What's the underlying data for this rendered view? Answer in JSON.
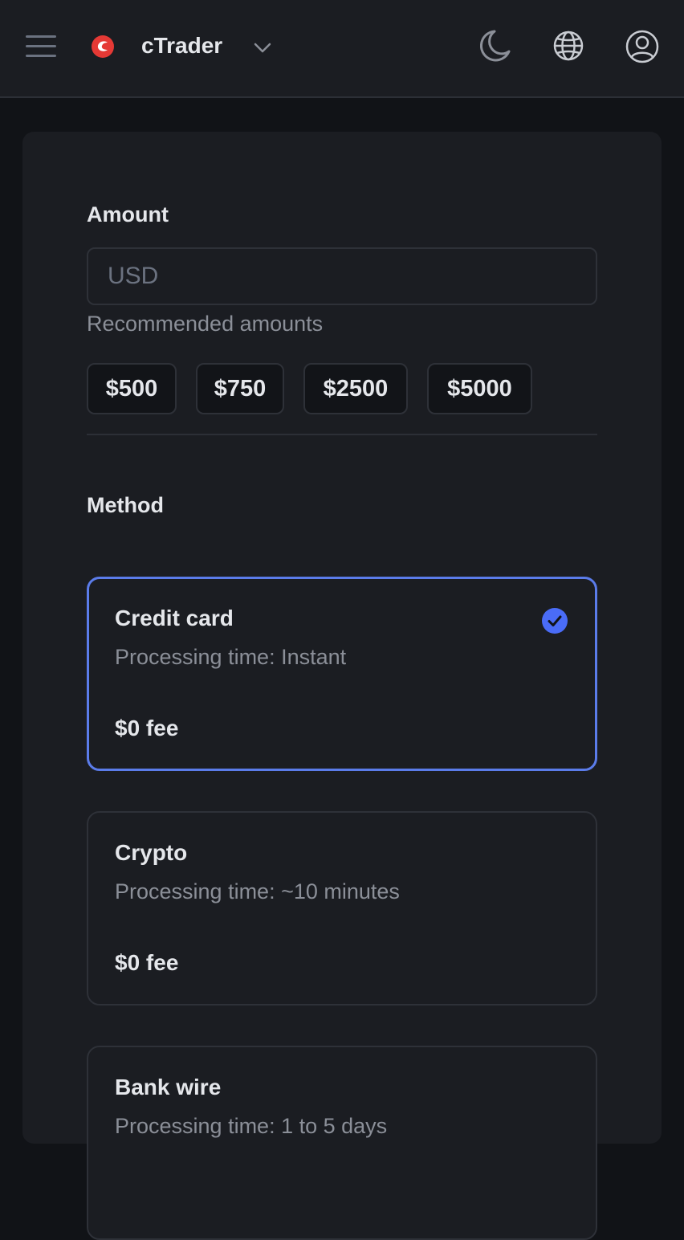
{
  "header": {
    "brand": "cTrader",
    "icons": [
      "menu-icon",
      "ctrader-logo",
      "chevron-down-icon",
      "moon-icon",
      "globe-icon",
      "user-icon"
    ]
  },
  "amount": {
    "label": "Amount",
    "placeholder": "USD",
    "recommended_label": "Recommended amounts",
    "recommended": [
      "$500",
      "$750",
      "$2500",
      "$5000"
    ]
  },
  "method": {
    "label": "Method",
    "options": [
      {
        "title": "Credit card",
        "time": "Processing time: Instant",
        "fee": "$0 fee",
        "selected": true
      },
      {
        "title": "Crypto",
        "time": "Processing time: ~10 minutes",
        "fee": "$0 fee",
        "selected": false
      },
      {
        "title": "Bank wire",
        "time": "Processing time: 1 to 5 days",
        "fee": "",
        "selected": false
      }
    ]
  },
  "colors": {
    "accent": "#5b7cea",
    "check": "#4a6cf7",
    "logo": "#e53935",
    "background": "#111317",
    "panel": "#1b1d22"
  }
}
